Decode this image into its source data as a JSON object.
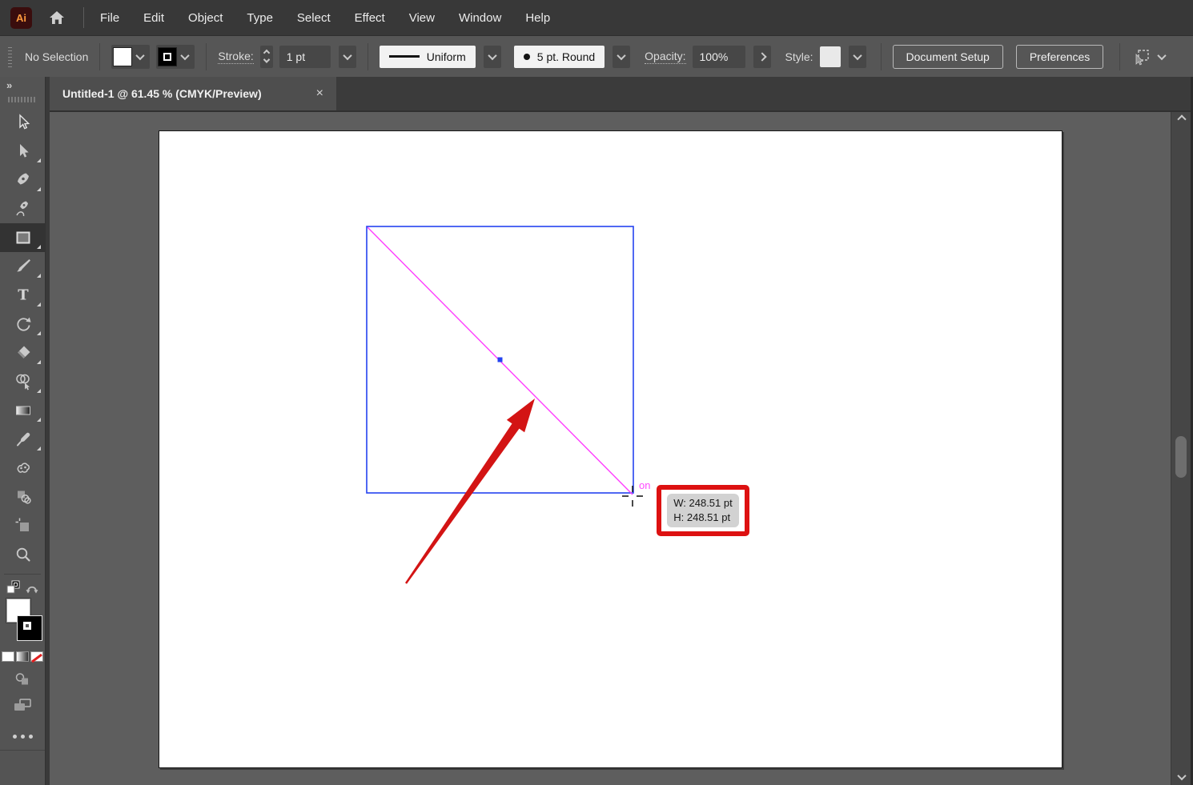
{
  "menubar": {
    "logo": "Ai",
    "items": [
      "File",
      "Edit",
      "Object",
      "Type",
      "Select",
      "Effect",
      "View",
      "Window",
      "Help"
    ]
  },
  "controlbar": {
    "selection_status": "No Selection",
    "stroke_label": "Stroke:",
    "stroke_weight": "1 pt",
    "width_profile": "Uniform",
    "brush": "5 pt. Round",
    "opacity_label": "Opacity:",
    "opacity_value": "100%",
    "style_label": "Style:",
    "document_setup_label": "Document Setup",
    "preferences_label": "Preferences"
  },
  "tab": {
    "title": "Untitled-1 @ 61.45 % (CMYK/Preview)",
    "close": "×"
  },
  "toolbar": {
    "collapse_glyph": "»",
    "tools": [
      {
        "name": "selection-tool"
      },
      {
        "name": "direct-selection-tool",
        "flyout": true
      },
      {
        "name": "pen-tool",
        "flyout": true
      },
      {
        "name": "curvature-tool"
      },
      {
        "name": "rectangle-tool",
        "active": true,
        "flyout": true
      },
      {
        "name": "paintbrush-tool",
        "flyout": true
      },
      {
        "name": "type-tool",
        "flyout": true
      },
      {
        "name": "rotate-tool",
        "flyout": true
      },
      {
        "name": "eraser-tool",
        "flyout": true
      },
      {
        "name": "shape-builder-tool",
        "flyout": true
      },
      {
        "name": "gradient-tool",
        "flyout": true
      },
      {
        "name": "eyedropper-tool",
        "flyout": true
      },
      {
        "name": "blend-tool"
      },
      {
        "name": "symbols-tool"
      },
      {
        "name": "artboard-tool"
      },
      {
        "name": "zoom-tool"
      }
    ]
  },
  "canvas": {
    "smart_guide_text": "on",
    "measurement": {
      "w": "W: 248.51 pt",
      "h": "H: 248.51 pt"
    },
    "colors": {
      "selection_blue": "#2443f0",
      "smart_guide_magenta": "#ff3dff",
      "arrow_red": "#d31414",
      "annotation_red": "#dd1111"
    }
  }
}
